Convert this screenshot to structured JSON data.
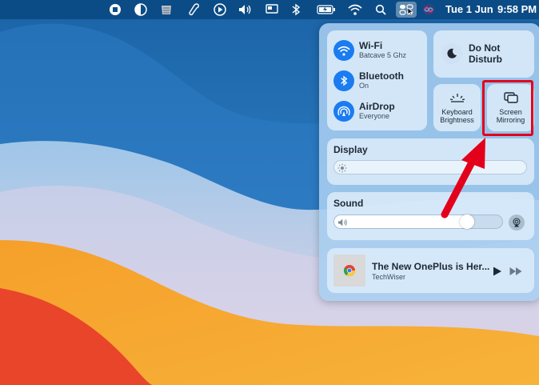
{
  "menubar": {
    "date": "Tue 1 Jun",
    "time": "9:58 PM",
    "icons": [
      "stop-icon",
      "half-circle-icon",
      "stack-icon",
      "script-icon",
      "play-circle-icon",
      "volume-icon",
      "display-icon",
      "bluetooth-icon",
      "battery-charging-icon",
      "wifi-icon",
      "search-icon",
      "control-center-icon",
      "siri-icon"
    ]
  },
  "network": {
    "wifi": {
      "title": "Wi-Fi",
      "subtitle": "Batcave 5 Ghz"
    },
    "bluetooth": {
      "title": "Bluetooth",
      "subtitle": "On"
    },
    "airdrop": {
      "title": "AirDrop",
      "subtitle": "Everyone"
    }
  },
  "dnd": {
    "label": "Do Not Disturb"
  },
  "keyboard": {
    "label_1": "Keyboard",
    "label_2": "Brightness"
  },
  "screen_mirroring": {
    "label_1": "Screen",
    "label_2": "Mirroring"
  },
  "display": {
    "title": "Display",
    "level": 0.0
  },
  "sound": {
    "title": "Sound",
    "level": 0.82
  },
  "now_playing": {
    "title": "The New OnePlus is Her...",
    "subtitle": "TechWiser"
  },
  "colors": {
    "accent": "#1a7cf0",
    "highlight": "#e3001b",
    "menubar": "#0c4c86"
  }
}
